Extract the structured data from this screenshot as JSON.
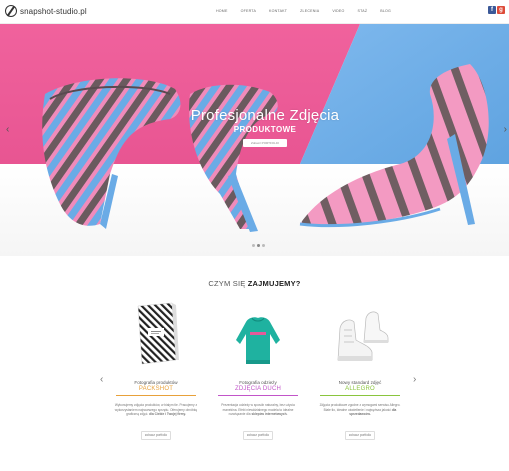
{
  "header": {
    "logo_text": "snapshot-studio.pl",
    "nav": [
      "HOME",
      "OFERTA",
      "KONTAKT",
      "ZLECENIA",
      "VIDEO",
      "STAŻ",
      "BLOG"
    ],
    "social": [
      {
        "icon": "facebook-icon",
        "glyph": "f",
        "color": "#3b5998"
      },
      {
        "icon": "google-plus-icon",
        "glyph": "g",
        "color": "#dd4b39"
      }
    ]
  },
  "hero": {
    "title": "Profesjonalne Zdjęcia",
    "subtitle": "PRODUKTOWE",
    "button": "Zobacz PORTFOLIO",
    "colors": {
      "pink": "#ee5e9a",
      "blue": "#6fb0e8"
    },
    "slides_count": 3,
    "active_slide": 2
  },
  "section": {
    "title_light": "CZYM SIĘ",
    "title_bold": "ZAJMUJEMY?"
  },
  "cards": [
    {
      "caption": "Fotografia produktów",
      "title": "PACKSHOT",
      "accent": "#e8a13a",
      "description": "Wykonujemy zdjęcia produktów, w białym tle. Pracujemy z wykorzystaniem najnowszego sprzętu. Oferujemy obróbkę graficzną zdjęć.",
      "description_bold": "dla Ciebie i Twojej firmy.",
      "button": "zobacz portfolio",
      "image": "striped-box-photo"
    },
    {
      "caption": "Fotografia odzieży",
      "title": "ZDJĘCIA DUCH",
      "accent": "#c255c9",
      "description": "Prezentacja odzieży w sposób naturalny, bez użycia manekina. Efekt niewidzialnego modela to idealne rozwiązanie dla",
      "description_bold": "sklepów internetowych.",
      "button": "zobacz portfolio",
      "image": "teal-sweater-photo"
    },
    {
      "caption": "Nowy standard zdjęć",
      "title": "ALLEGRO",
      "accent": "#8ac53e",
      "description": "Zdjęcia produktowe zgodne z wymogami serwisu Allegro. Białe tło, idealne oświetlenie i najwyższa jakość",
      "description_bold": "dla sprzedawców.",
      "button": "zobacz portfolio",
      "image": "white-sneakers-photo"
    }
  ]
}
